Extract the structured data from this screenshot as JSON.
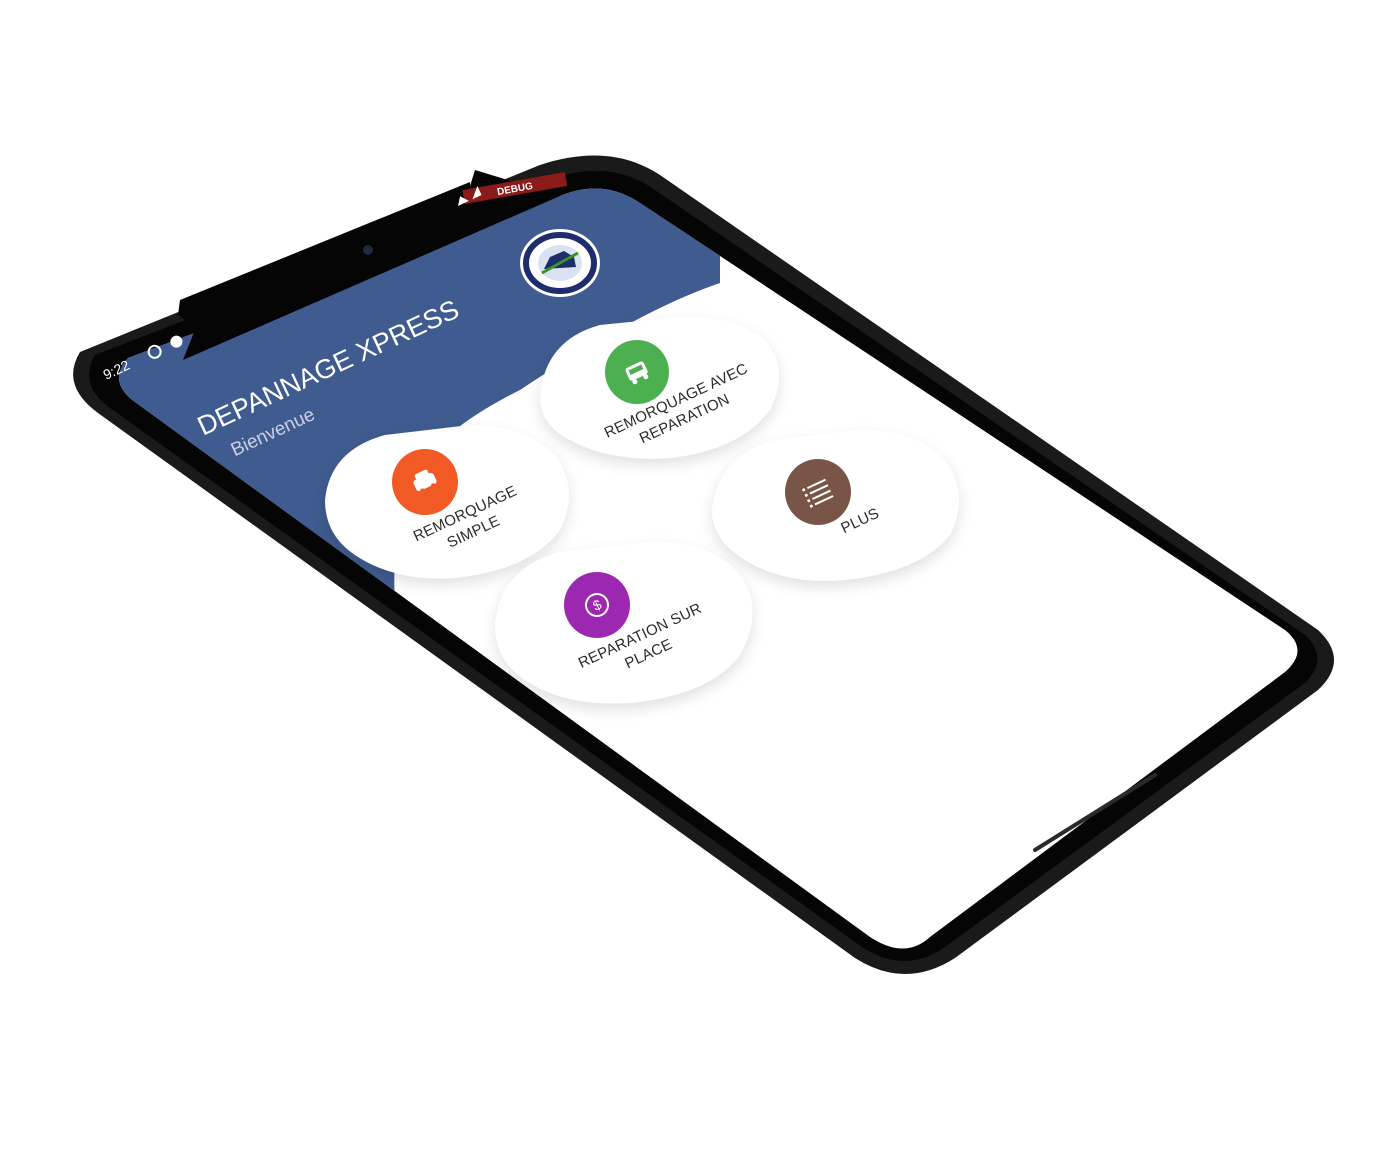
{
  "status_bar": {
    "time": "9:22",
    "debug_banner": "DEBUG"
  },
  "header": {
    "title": "DEPANNAGE XPRESS",
    "subtitle": "Bienvenue",
    "logo_icon": "tow-truck-logo-icon",
    "background_color": "#3f5b8f"
  },
  "menu": {
    "items": [
      {
        "id": "remorquage-simple",
        "line1": "REMORQUAGE",
        "line2": "SIMPLE",
        "icon": "car-icon",
        "color": "#f15a24"
      },
      {
        "id": "remorquage-avec-reparation",
        "line1": "REMORQUAGE AVEC",
        "line2": "REPARATION",
        "icon": "bus-icon",
        "color": "#4caf50"
      },
      {
        "id": "plus",
        "line1": "PLUS",
        "line2": "",
        "icon": "list-icon",
        "color": "#795548"
      },
      {
        "id": "reparation-sur-place",
        "line1": "REPARATION SUR",
        "line2": "PLACE",
        "icon": "dollar-icon",
        "color": "#9c27b0"
      }
    ]
  }
}
